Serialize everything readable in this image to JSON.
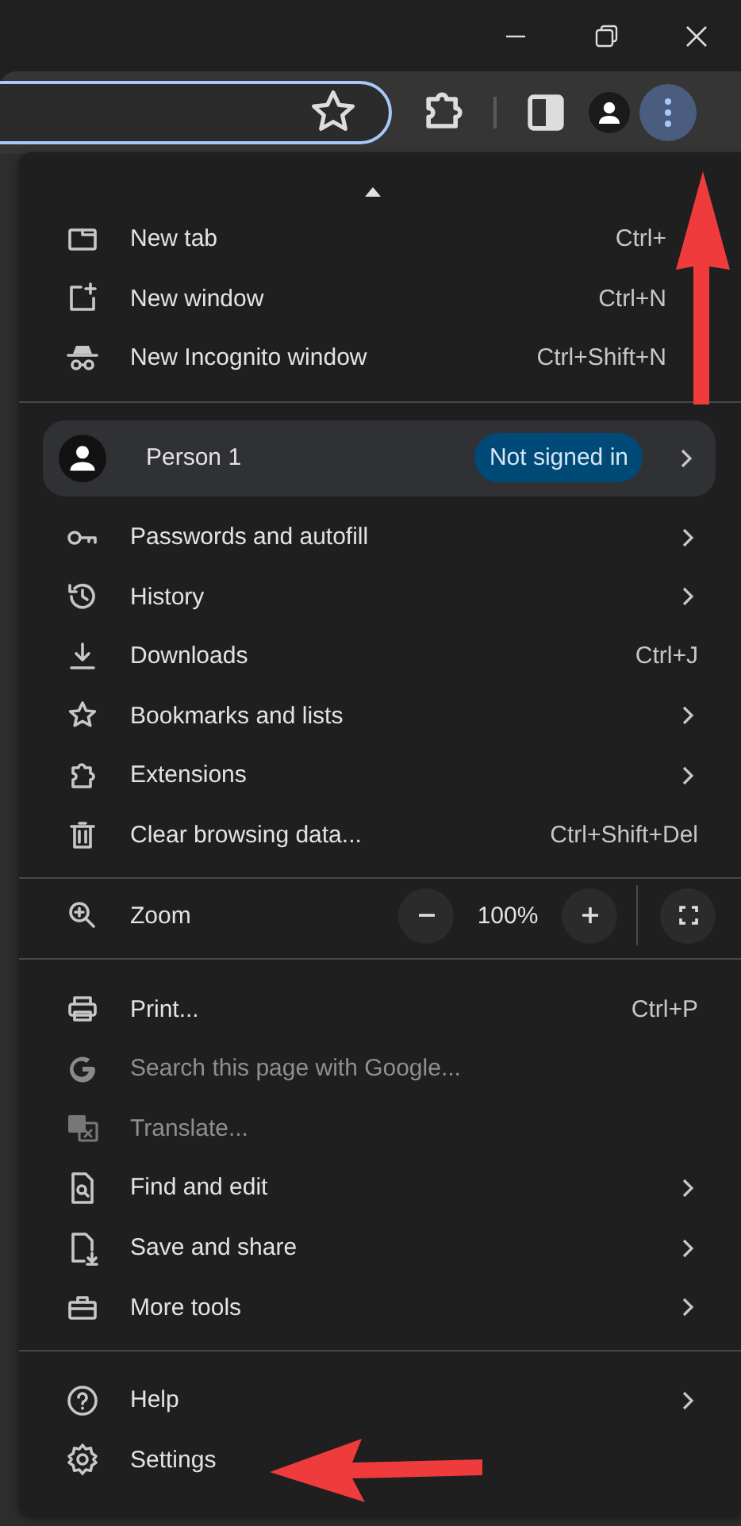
{
  "menu": {
    "sections": [
      {
        "items": [
          {
            "kind": "item",
            "label": "New tab",
            "shortcut": "Ctrl+",
            "submenu": false,
            "disabled": false
          },
          {
            "kind": "item",
            "label": "New window",
            "shortcut": "Ctrl+N",
            "submenu": false,
            "disabled": false
          },
          {
            "kind": "item",
            "label": "New Incognito window",
            "shortcut": "Ctrl+Shift+N",
            "submenu": false,
            "disabled": false
          }
        ]
      },
      {
        "items": [
          {
            "kind": "profile",
            "label": "Person 1",
            "badge": "Not signed in",
            "submenu": true
          },
          {
            "kind": "item",
            "label": "Passwords and autofill",
            "submenu": true,
            "disabled": false
          },
          {
            "kind": "item",
            "label": "History",
            "submenu": true,
            "disabled": false
          },
          {
            "kind": "item",
            "label": "Downloads",
            "shortcut": "Ctrl+J",
            "submenu": false,
            "disabled": false
          },
          {
            "kind": "item",
            "label": "Bookmarks and lists",
            "submenu": true,
            "disabled": false
          },
          {
            "kind": "item",
            "label": "Extensions",
            "submenu": true,
            "disabled": false
          },
          {
            "kind": "item",
            "label": "Clear browsing data...",
            "shortcut": "Ctrl+Shift+Del",
            "submenu": false,
            "disabled": false
          }
        ]
      },
      {
        "items": [
          {
            "kind": "zoom",
            "label": "Zoom",
            "value": "100%"
          }
        ]
      },
      {
        "items": [
          {
            "kind": "item",
            "label": "Print...",
            "shortcut": "Ctrl+P",
            "submenu": false,
            "disabled": false
          },
          {
            "kind": "item",
            "label": "Search this page with Google...",
            "submenu": false,
            "disabled": true
          },
          {
            "kind": "item",
            "label": "Translate...",
            "submenu": false,
            "disabled": true
          },
          {
            "kind": "item",
            "label": "Find and edit",
            "submenu": true,
            "disabled": false
          },
          {
            "kind": "item",
            "label": "Save and share",
            "submenu": true,
            "disabled": false
          },
          {
            "kind": "item",
            "label": "More tools",
            "submenu": true,
            "disabled": false
          }
        ]
      },
      {
        "items": [
          {
            "kind": "item",
            "label": "Help",
            "submenu": true,
            "disabled": false
          },
          {
            "kind": "item",
            "label": "Settings",
            "submenu": false,
            "disabled": false
          }
        ]
      }
    ]
  }
}
